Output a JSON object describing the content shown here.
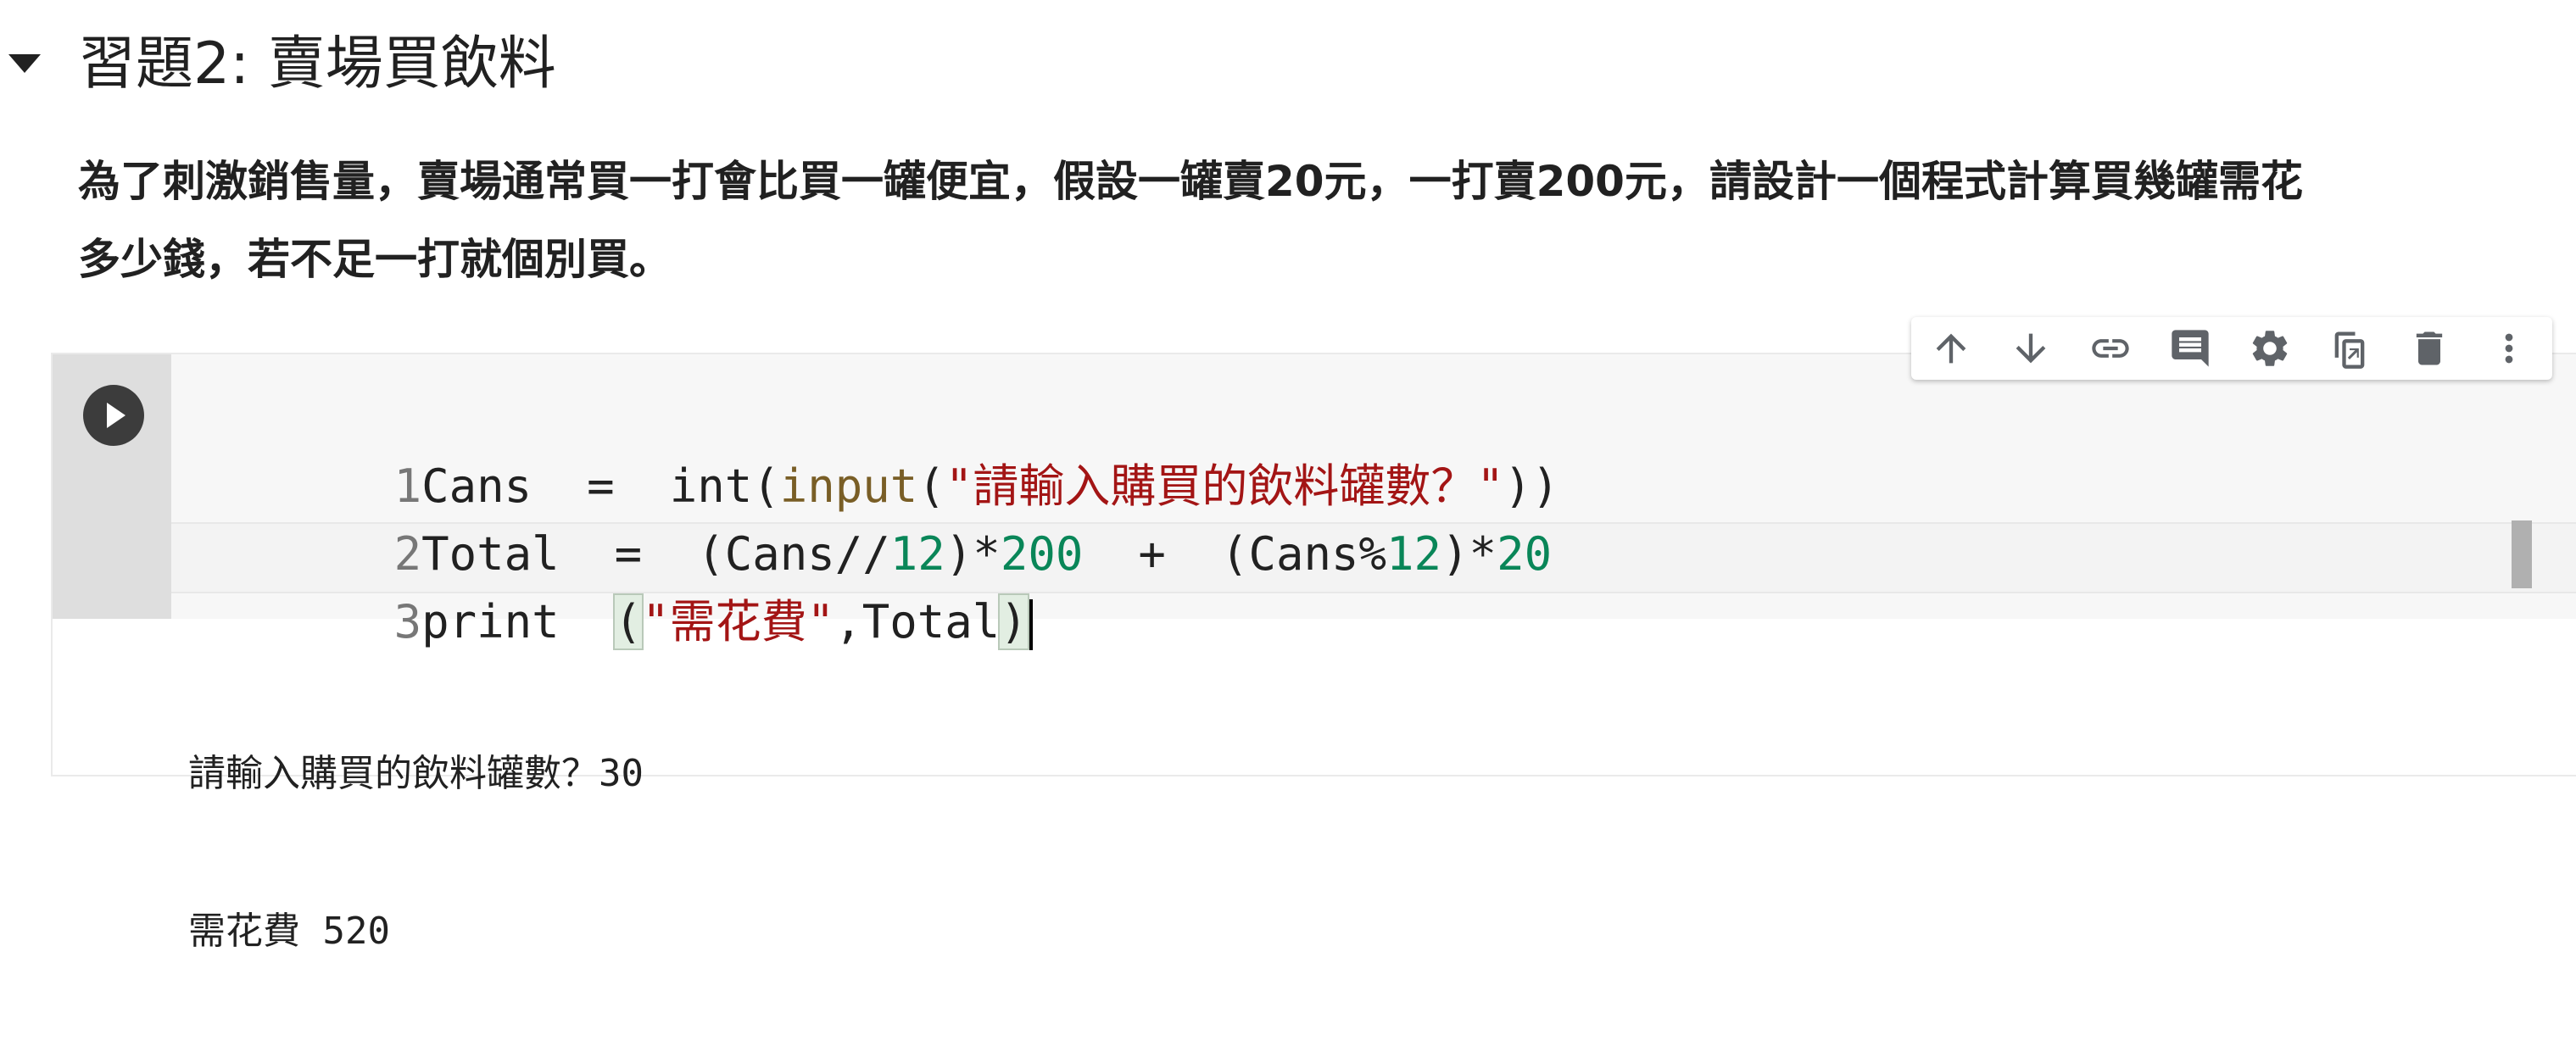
{
  "section": {
    "title": "習題2: 賣場買飲料"
  },
  "description": {
    "line1": "為了刺激銷售量，賣場通常買一打會比買一罐便宜，假設一罐賣20元，一打賣200元，請設計一個程式計算買幾罐需花",
    "line2": "多少錢，若不足一打就個別買。"
  },
  "code": {
    "lines": [
      {
        "num": "1",
        "a": "Cans  =  ",
        "b": "int",
        "c": "(",
        "d": "input",
        "e": "(",
        "f": "\"請輸入購買的飲料罐數？\"",
        "g": "))"
      },
      {
        "num": "2",
        "a": "Total  =  (Cans//",
        "b": "12",
        "c": ")*",
        "d": "200",
        "e": "  +  (Cans%",
        "f": "12",
        "g": ")*",
        "h": "20"
      },
      {
        "num": "3",
        "a": "print  ",
        "b": "(",
        "c": "\"需花費\"",
        "d": ",Total",
        "e": ")"
      }
    ]
  },
  "output": {
    "line1": "請輸入購買的飲料罐數？30",
    "line2": "需花費 520"
  },
  "toolbar": {
    "icons": [
      "arrow-up-icon",
      "arrow-down-icon",
      "link-icon",
      "comment-icon",
      "gear-icon",
      "mirror-cell-icon",
      "trash-icon",
      "more-vert-icon"
    ]
  },
  "colors": {
    "string": "#a31515",
    "number": "#098658",
    "function": "#795e26"
  }
}
